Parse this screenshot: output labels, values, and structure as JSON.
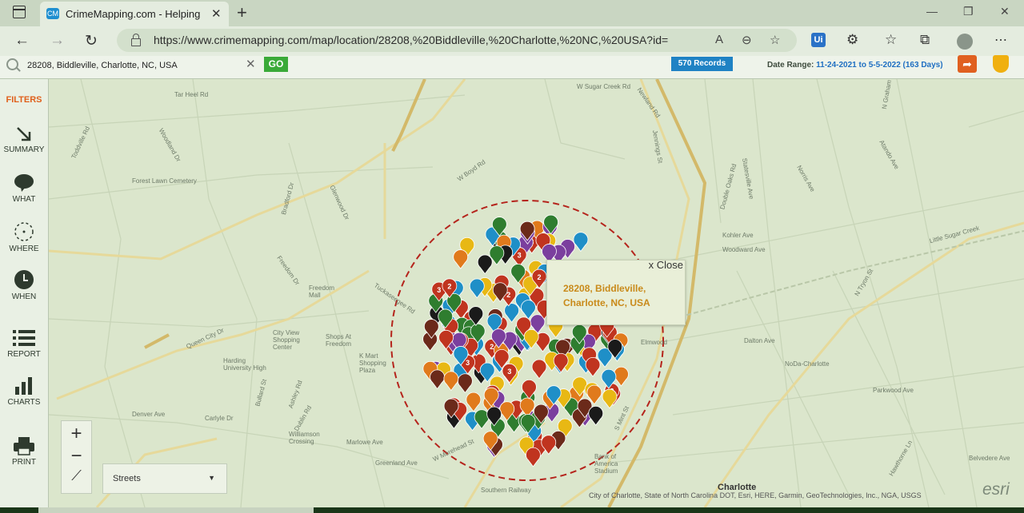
{
  "browser": {
    "tab_title": "CrimeMapping.com - Helping You Build a Safer Community",
    "favicon_text": "CM",
    "url": "https://www.crimemapping.com/map/location/28208,%20Biddleville,%20Charlotte,%20NC,%20USA?id="
  },
  "toolbar": {
    "search_value": "28208, Biddleville, Charlotte, NC, USA",
    "go_label": "GO",
    "records_label": "570 Records",
    "date_range_label": "Date Range:",
    "date_range_value": "11-24-2021 to 5-5-2022 (163 Days)"
  },
  "sidebar": {
    "filters_label": "FILTERS",
    "items": [
      {
        "label": "SUMMARY",
        "icon": "arrow-down-right-icon"
      },
      {
        "label": "WHAT",
        "icon": "speech-bubble-icon"
      },
      {
        "label": "WHERE",
        "icon": "target-icon"
      },
      {
        "label": "WHEN",
        "icon": "clock-icon"
      },
      {
        "label": "REPORT",
        "icon": "list-icon"
      },
      {
        "label": "CHARTS",
        "icon": "bar-chart-icon"
      },
      {
        "label": "PRINT",
        "icon": "printer-icon"
      }
    ]
  },
  "map": {
    "popup": {
      "close_label": "x Close",
      "address": "28208, Biddleville, Charlotte, NC, USA"
    },
    "basemap_label": "Streets",
    "city_label": "Charlotte",
    "attribution": "City of Charlotte, State of North Carolina DOT, Esri, HERE, Garmin, GeoTechnologies, Inc., NGA, USGS",
    "esri_logo": "esri",
    "street_labels": [
      "Tar Heel Rd",
      "Toddville Rd",
      "Woodland Dr",
      "Forest Lawn Cemetery",
      "Bradford Dr",
      "Freedom Dr",
      "Queen City Dr",
      "Denver Ave",
      "Carlyle Dr",
      "Ashley Rd",
      "Dublin Rd",
      "Harding University High",
      "Bullard St",
      "City View Shopping Center",
      "Shops At Freedom",
      "K Mart Shopping Plaza",
      "Williamson Crossing",
      "Marlowe Ave",
      "Greenland Ave",
      "W Morehead St",
      "Freedom Mall",
      "Tuckaseegee Rd",
      "Glenwood Dr",
      "Kohler Ave",
      "Woodward Ave",
      "Dalton Ave",
      "Elmwood",
      "NoDa-Charlotte",
      "Parkwood Ave",
      "Atando Ave",
      "Bank of America Stadium",
      "S Mint St",
      "Belvedere Ave",
      "Hawthorne Ln",
      "W Boyd Rd",
      "Jennings St",
      "Newland Rd",
      "Statesville Ave",
      "Double Oaks Rd",
      "Norris Ave",
      "N Tryon St",
      "N Graham St",
      "Southern Railway",
      "Little Sugar Creek",
      "W Sugar Creek Rd"
    ],
    "marker_badge_numbers": [
      "2",
      "3"
    ]
  },
  "colors": {
    "accent_orange": "#e0601c",
    "go_green": "#3aaa38",
    "records_blue": "#1f82c4",
    "popup_text": "#c98a1a",
    "radius_circle": "#b5241c"
  }
}
